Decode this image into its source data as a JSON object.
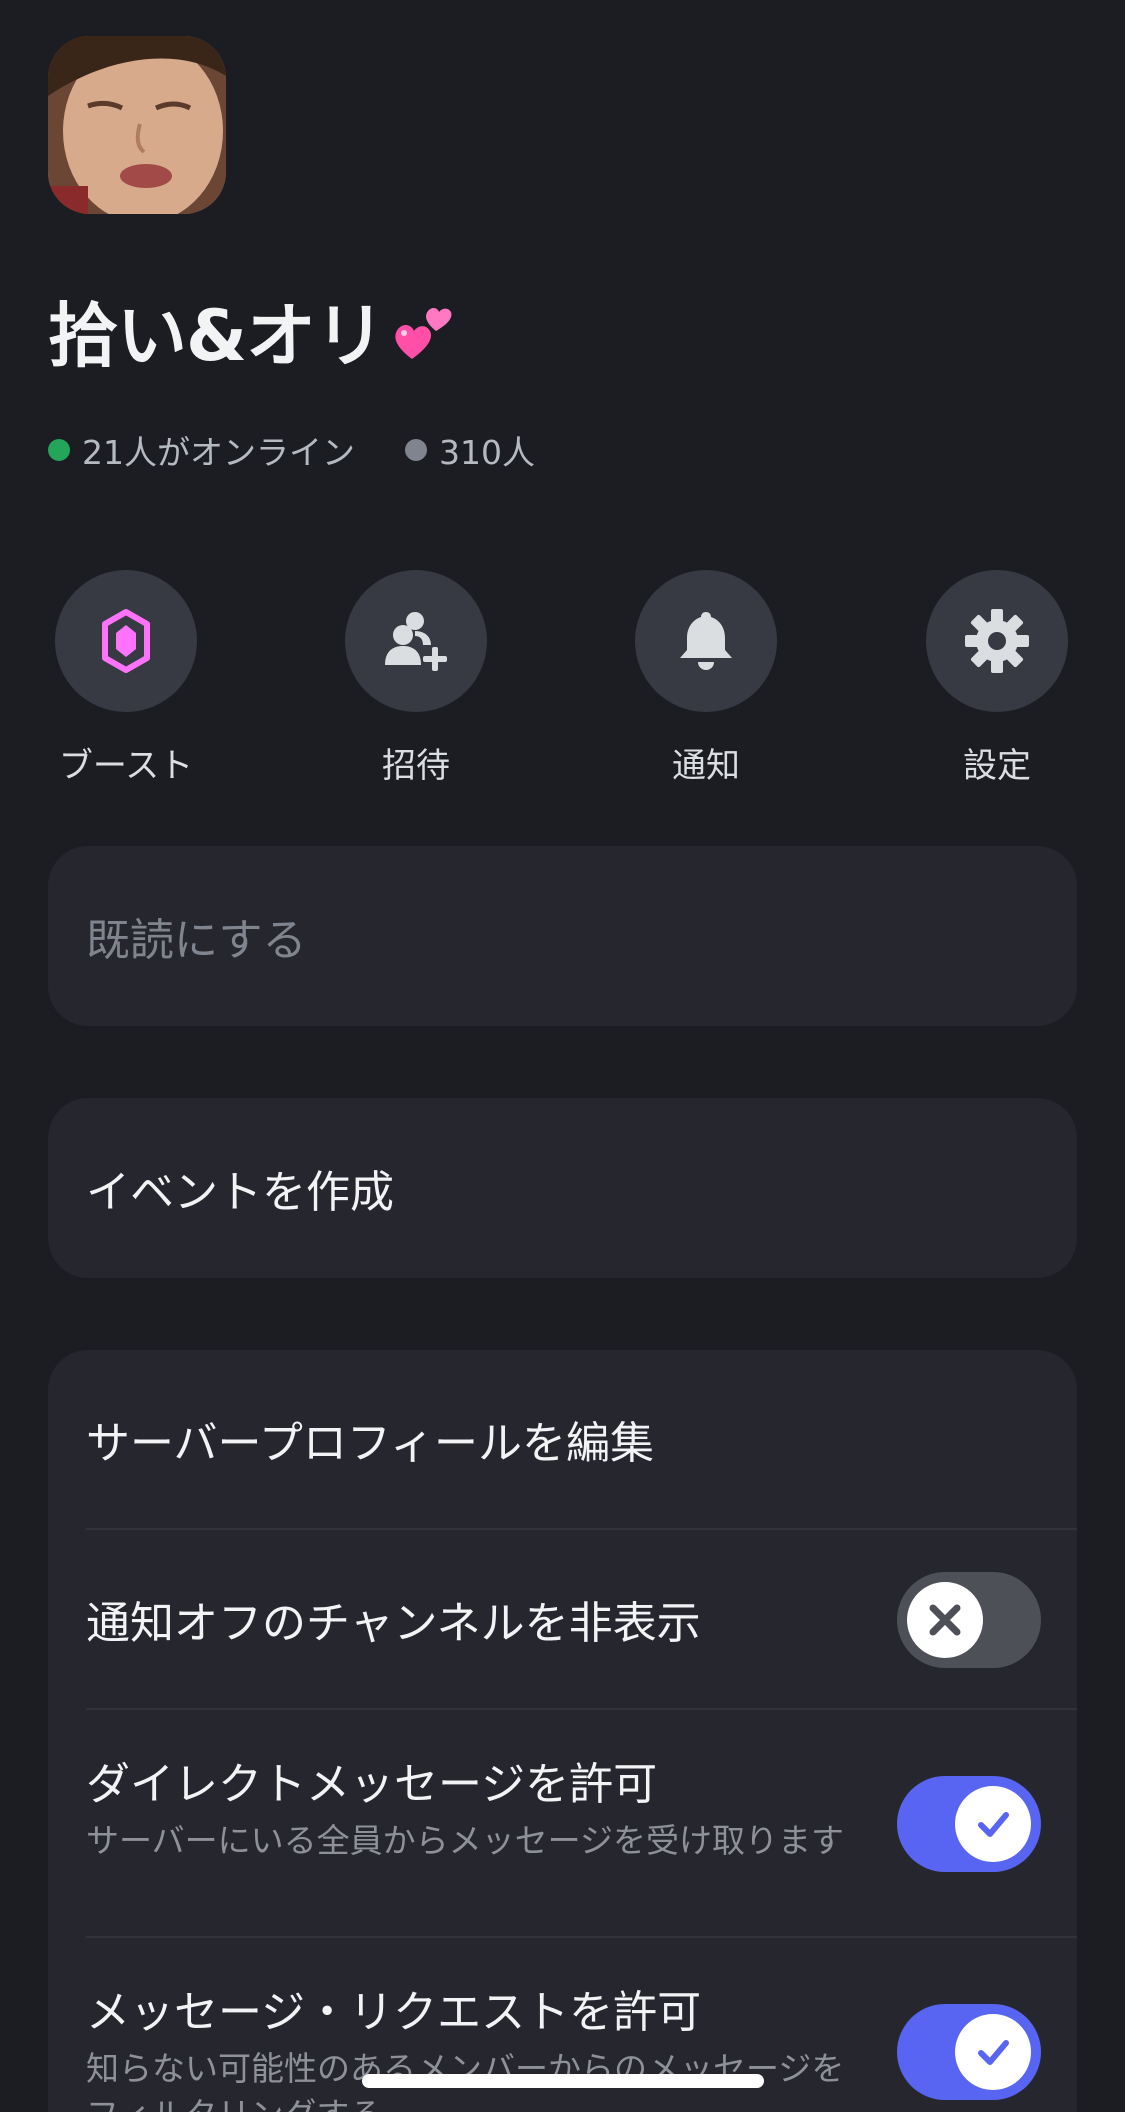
{
  "server": {
    "name": "拾い&オリ",
    "online_text": "21人がオンライン",
    "member_text": "310人",
    "online_color": "#23a55a",
    "member_dot_color": "#80848e"
  },
  "actions": [
    {
      "label": "ブースト",
      "icon": "boost-gem-icon"
    },
    {
      "label": "招待",
      "icon": "invite-person-plus-icon"
    },
    {
      "label": "通知",
      "icon": "bell-icon"
    },
    {
      "label": "設定",
      "icon": "gear-icon"
    }
  ],
  "mark_read": {
    "label": "既読にする",
    "enabled": false
  },
  "create_event": {
    "label": "イベントを作成"
  },
  "settings": {
    "edit_profile": {
      "label": "サーバープロフィールを編集"
    },
    "hide_muted": {
      "label": "通知オフのチャンネルを非表示",
      "on": false
    },
    "allow_dm": {
      "label": "ダイレクトメッセージを許可",
      "sub": "サーバーにいる全員からメッセージを受け取ります",
      "on": true
    },
    "allow_requests": {
      "label": "メッセージ・リクエストを許可",
      "sub": "知らない可能性のあるメンバーからのメッセージをフィルタリングする",
      "on": true
    }
  },
  "colors": {
    "background": "#1c1d22",
    "card": "#26272e",
    "toggle_on": "#5865f2",
    "toggle_off": "#4e5058",
    "boost_pink": "#ff73fa"
  }
}
